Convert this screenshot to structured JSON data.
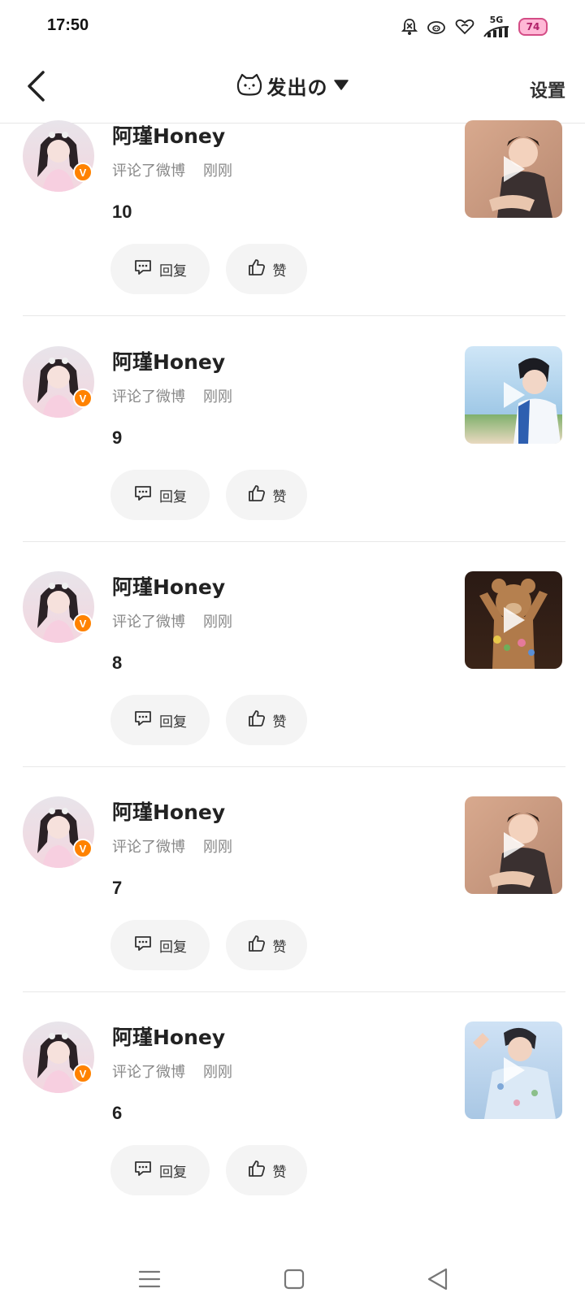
{
  "status_bar": {
    "time": "17:50",
    "network": "5G",
    "battery": "74"
  },
  "nav": {
    "title": "发出の",
    "settings": "设置"
  },
  "items": [
    {
      "user": "阿瑾Honey",
      "action": "评论了微博",
      "time": "刚刚",
      "text": "10",
      "reply": "回复",
      "like": "赞",
      "thumb": "thumb-a"
    },
    {
      "user": "阿瑾Honey",
      "action": "评论了微博",
      "time": "刚刚",
      "text": "9",
      "reply": "回复",
      "like": "赞",
      "thumb": "thumb-b"
    },
    {
      "user": "阿瑾Honey",
      "action": "评论了微博",
      "time": "刚刚",
      "text": "8",
      "reply": "回复",
      "like": "赞",
      "thumb": "thumb-c"
    },
    {
      "user": "阿瑾Honey",
      "action": "评论了微博",
      "time": "刚刚",
      "text": "7",
      "reply": "回复",
      "like": "赞",
      "thumb": "thumb-a"
    },
    {
      "user": "阿瑾Honey",
      "action": "评论了微博",
      "time": "刚刚",
      "text": "6",
      "reply": "回复",
      "like": "赞",
      "thumb": "thumb-d"
    }
  ],
  "icons": {
    "back": "chevron-left-icon",
    "title_prefix": "cat-face-icon",
    "dropdown": "caret-down-icon",
    "reply": "comment-icon",
    "like": "thumbs-up-icon",
    "verified": "verified-badge-icon",
    "play": "play-icon",
    "menu": "menu-icon",
    "home": "square-home-icon",
    "back_nav": "triangle-back-icon"
  },
  "colors": {
    "accent": "#ff8200",
    "battery": "#ffb8d6"
  },
  "bottom_nav": {}
}
